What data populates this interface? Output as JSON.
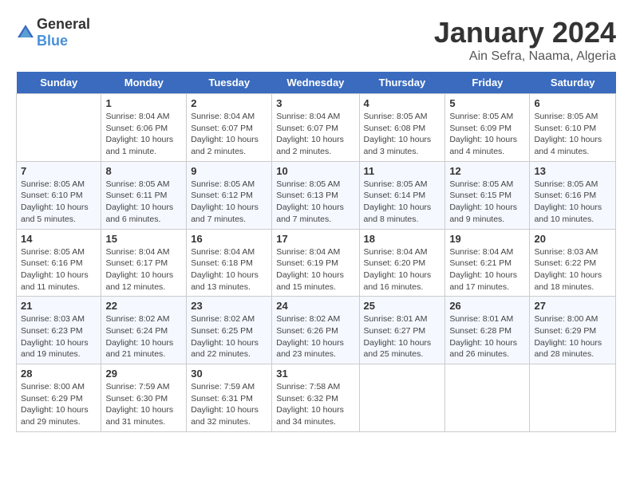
{
  "header": {
    "logo_general": "General",
    "logo_blue": "Blue",
    "title": "January 2024",
    "subtitle": "Ain Sefra, Naama, Algeria"
  },
  "columns": [
    "Sunday",
    "Monday",
    "Tuesday",
    "Wednesday",
    "Thursday",
    "Friday",
    "Saturday"
  ],
  "weeks": [
    [
      {
        "num": "",
        "info": ""
      },
      {
        "num": "1",
        "info": "Sunrise: 8:04 AM\nSunset: 6:06 PM\nDaylight: 10 hours\nand 1 minute."
      },
      {
        "num": "2",
        "info": "Sunrise: 8:04 AM\nSunset: 6:07 PM\nDaylight: 10 hours\nand 2 minutes."
      },
      {
        "num": "3",
        "info": "Sunrise: 8:04 AM\nSunset: 6:07 PM\nDaylight: 10 hours\nand 2 minutes."
      },
      {
        "num": "4",
        "info": "Sunrise: 8:05 AM\nSunset: 6:08 PM\nDaylight: 10 hours\nand 3 minutes."
      },
      {
        "num": "5",
        "info": "Sunrise: 8:05 AM\nSunset: 6:09 PM\nDaylight: 10 hours\nand 4 minutes."
      },
      {
        "num": "6",
        "info": "Sunrise: 8:05 AM\nSunset: 6:10 PM\nDaylight: 10 hours\nand 4 minutes."
      }
    ],
    [
      {
        "num": "7",
        "info": "Sunrise: 8:05 AM\nSunset: 6:10 PM\nDaylight: 10 hours\nand 5 minutes."
      },
      {
        "num": "8",
        "info": "Sunrise: 8:05 AM\nSunset: 6:11 PM\nDaylight: 10 hours\nand 6 minutes."
      },
      {
        "num": "9",
        "info": "Sunrise: 8:05 AM\nSunset: 6:12 PM\nDaylight: 10 hours\nand 7 minutes."
      },
      {
        "num": "10",
        "info": "Sunrise: 8:05 AM\nSunset: 6:13 PM\nDaylight: 10 hours\nand 7 minutes."
      },
      {
        "num": "11",
        "info": "Sunrise: 8:05 AM\nSunset: 6:14 PM\nDaylight: 10 hours\nand 8 minutes."
      },
      {
        "num": "12",
        "info": "Sunrise: 8:05 AM\nSunset: 6:15 PM\nDaylight: 10 hours\nand 9 minutes."
      },
      {
        "num": "13",
        "info": "Sunrise: 8:05 AM\nSunset: 6:16 PM\nDaylight: 10 hours\nand 10 minutes."
      }
    ],
    [
      {
        "num": "14",
        "info": "Sunrise: 8:05 AM\nSunset: 6:16 PM\nDaylight: 10 hours\nand 11 minutes."
      },
      {
        "num": "15",
        "info": "Sunrise: 8:04 AM\nSunset: 6:17 PM\nDaylight: 10 hours\nand 12 minutes."
      },
      {
        "num": "16",
        "info": "Sunrise: 8:04 AM\nSunset: 6:18 PM\nDaylight: 10 hours\nand 13 minutes."
      },
      {
        "num": "17",
        "info": "Sunrise: 8:04 AM\nSunset: 6:19 PM\nDaylight: 10 hours\nand 15 minutes."
      },
      {
        "num": "18",
        "info": "Sunrise: 8:04 AM\nSunset: 6:20 PM\nDaylight: 10 hours\nand 16 minutes."
      },
      {
        "num": "19",
        "info": "Sunrise: 8:04 AM\nSunset: 6:21 PM\nDaylight: 10 hours\nand 17 minutes."
      },
      {
        "num": "20",
        "info": "Sunrise: 8:03 AM\nSunset: 6:22 PM\nDaylight: 10 hours\nand 18 minutes."
      }
    ],
    [
      {
        "num": "21",
        "info": "Sunrise: 8:03 AM\nSunset: 6:23 PM\nDaylight: 10 hours\nand 19 minutes."
      },
      {
        "num": "22",
        "info": "Sunrise: 8:02 AM\nSunset: 6:24 PM\nDaylight: 10 hours\nand 21 minutes."
      },
      {
        "num": "23",
        "info": "Sunrise: 8:02 AM\nSunset: 6:25 PM\nDaylight: 10 hours\nand 22 minutes."
      },
      {
        "num": "24",
        "info": "Sunrise: 8:02 AM\nSunset: 6:26 PM\nDaylight: 10 hours\nand 23 minutes."
      },
      {
        "num": "25",
        "info": "Sunrise: 8:01 AM\nSunset: 6:27 PM\nDaylight: 10 hours\nand 25 minutes."
      },
      {
        "num": "26",
        "info": "Sunrise: 8:01 AM\nSunset: 6:28 PM\nDaylight: 10 hours\nand 26 minutes."
      },
      {
        "num": "27",
        "info": "Sunrise: 8:00 AM\nSunset: 6:29 PM\nDaylight: 10 hours\nand 28 minutes."
      }
    ],
    [
      {
        "num": "28",
        "info": "Sunrise: 8:00 AM\nSunset: 6:29 PM\nDaylight: 10 hours\nand 29 minutes."
      },
      {
        "num": "29",
        "info": "Sunrise: 7:59 AM\nSunset: 6:30 PM\nDaylight: 10 hours\nand 31 minutes."
      },
      {
        "num": "30",
        "info": "Sunrise: 7:59 AM\nSunset: 6:31 PM\nDaylight: 10 hours\nand 32 minutes."
      },
      {
        "num": "31",
        "info": "Sunrise: 7:58 AM\nSunset: 6:32 PM\nDaylight: 10 hours\nand 34 minutes."
      },
      {
        "num": "",
        "info": ""
      },
      {
        "num": "",
        "info": ""
      },
      {
        "num": "",
        "info": ""
      }
    ]
  ]
}
